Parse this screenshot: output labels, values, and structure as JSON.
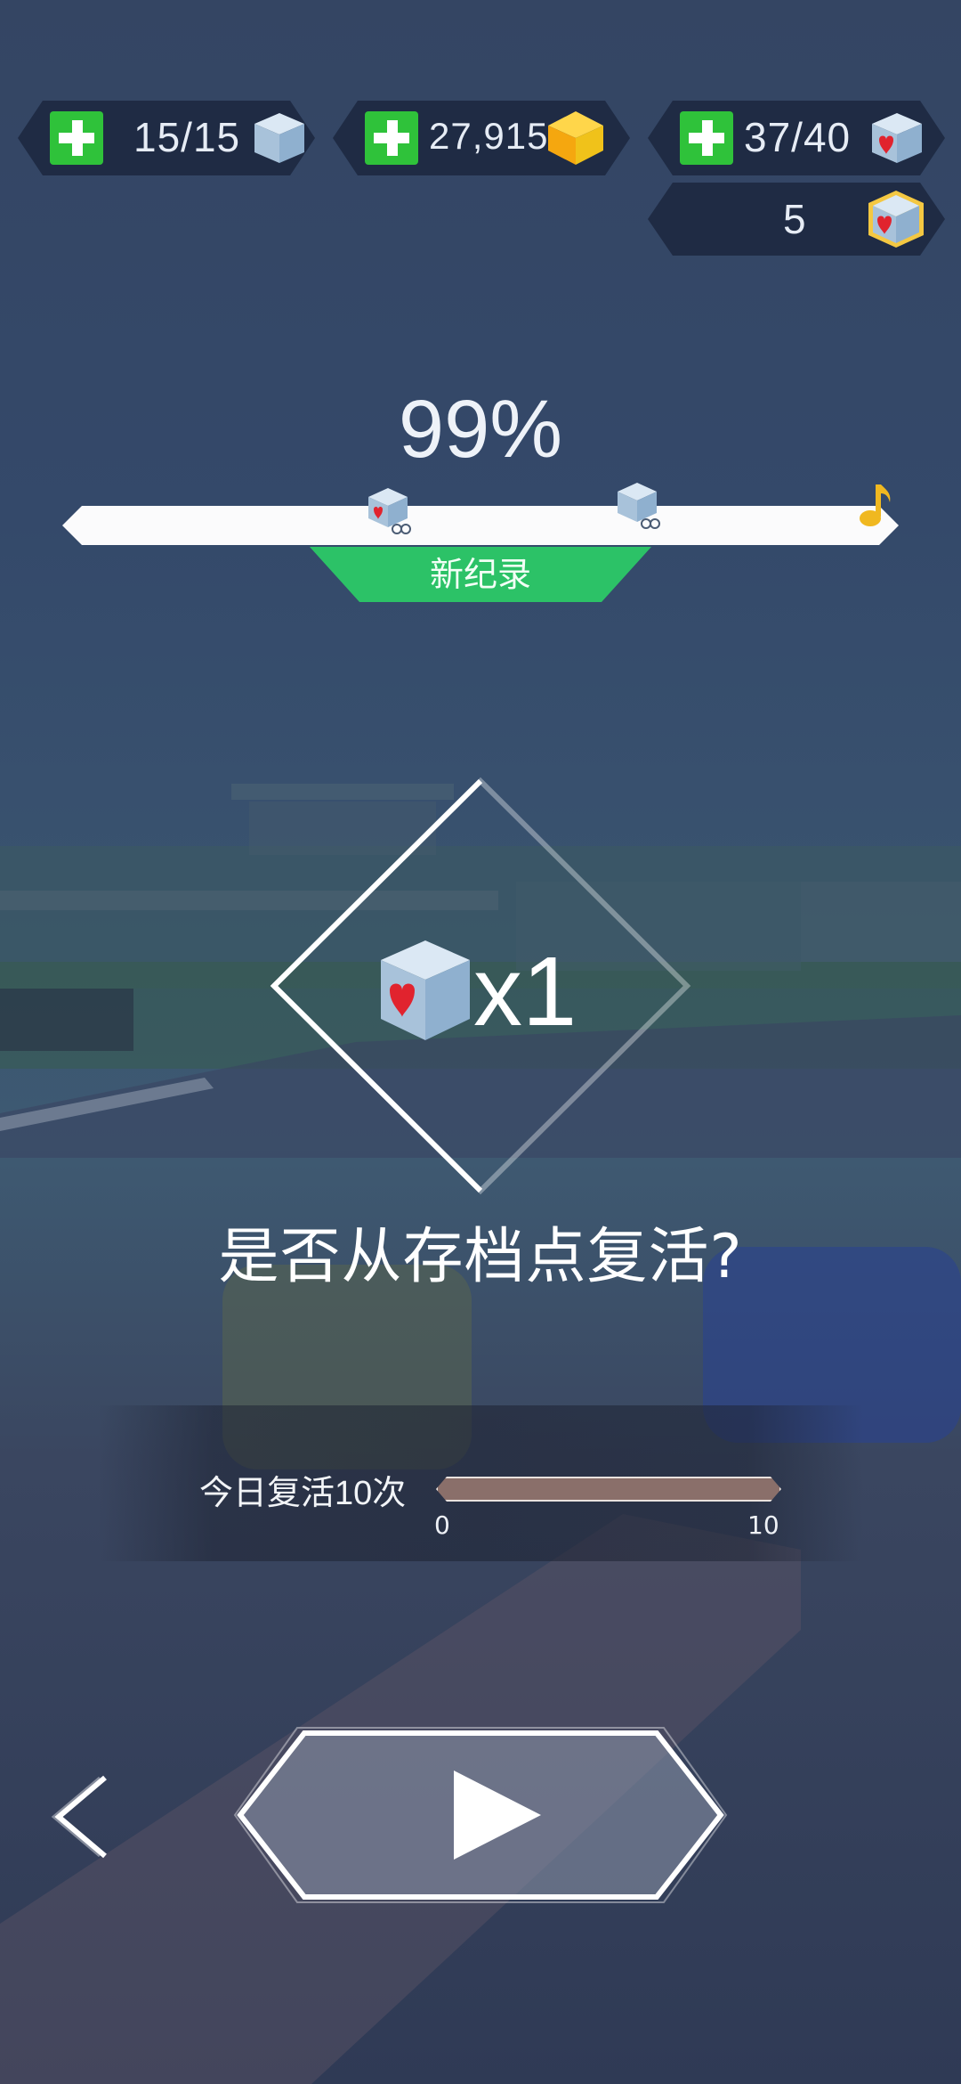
{
  "hud": {
    "lives": {
      "value": "15/15",
      "icon": "ice-cube-icon"
    },
    "gems": {
      "value": "27,915",
      "icon": "gold-gem-icon"
    },
    "hearts": {
      "value": "37/40",
      "icon": "heart-cube-icon"
    },
    "revive_cubes": {
      "value": "5",
      "icon": "revive-cube-icon"
    }
  },
  "progress": {
    "percent_label": "99%",
    "percent": 99,
    "badge": "新纪录",
    "markers": [
      "heart-cube-checkpoint-icon",
      "cube-checkpoint-icon",
      "music-note-icon"
    ]
  },
  "revive_cost": {
    "multiplier": "x1",
    "icon": "heart-cube-icon"
  },
  "question": "是否从存档点复活?",
  "daily": {
    "label_prefix": "今日复活",
    "count": "10",
    "suffix": "次",
    "min": "0",
    "max": "10",
    "used_fraction": 1.0
  },
  "controls": {
    "back": "back-arrow-icon",
    "play": "play-icon"
  },
  "colors": {
    "accent_green": "#2cc267",
    "plus_green": "#2fc23a",
    "hud_bg": "#1f2b44"
  }
}
